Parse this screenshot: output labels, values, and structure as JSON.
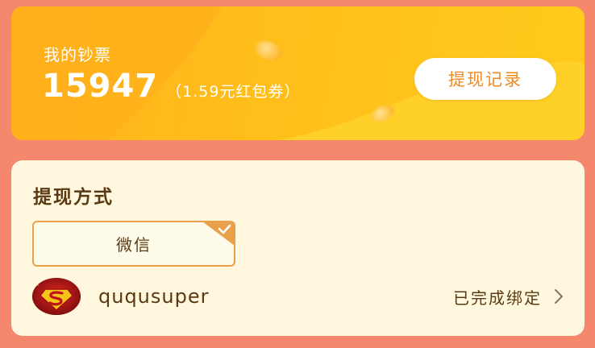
{
  "balance": {
    "title": "我的钞票",
    "amount": "15947",
    "sub": "（1.59元红包券）",
    "record_button": "提现记录"
  },
  "withdraw_method": {
    "title": "提现方式",
    "option_label": "微信",
    "selected": true,
    "account_name": "ququsuper",
    "bind_status": "已完成绑定"
  },
  "icons": {
    "selected_corner": "check-icon",
    "row_arrow": "chevron-right-icon",
    "avatar": "superman-avatar"
  },
  "colors": {
    "page_background": "#f4876c",
    "card_gradient_start": "#ffb21c",
    "card_gradient_end": "#ffcc1c",
    "record_button_text": "#f08a1c",
    "method_card_background": "#fff8df",
    "selected_border": "#e8a04a",
    "text_brown": "#5a3a12"
  }
}
